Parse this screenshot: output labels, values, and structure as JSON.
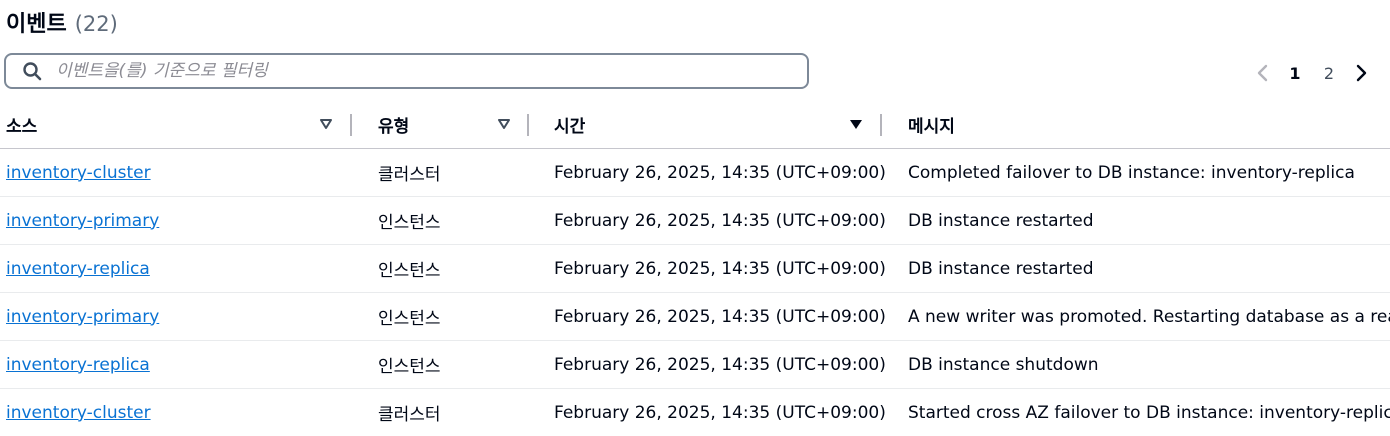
{
  "header": {
    "title": "이벤트",
    "count": "(22)"
  },
  "search": {
    "placeholder": "이벤트을(를) 기준으로 필터링"
  },
  "pagination": {
    "pages": [
      "1",
      "2"
    ],
    "current": "1"
  },
  "table": {
    "columns": [
      {
        "label": "소스"
      },
      {
        "label": "유형"
      },
      {
        "label": "시간"
      },
      {
        "label": "메시지"
      }
    ],
    "rows": [
      {
        "source": "inventory-cluster",
        "type": "클러스터",
        "time": "February 26, 2025, 14:35 (UTC+09:00)",
        "message": "Completed failover to DB instance: inventory-replica"
      },
      {
        "source": "inventory-primary",
        "type": "인스턴스",
        "time": "February 26, 2025, 14:35 (UTC+09:00)",
        "message": "DB instance restarted"
      },
      {
        "source": "inventory-replica",
        "type": "인스턴스",
        "time": "February 26, 2025, 14:35 (UTC+09:00)",
        "message": "DB instance restarted"
      },
      {
        "source": "inventory-primary",
        "type": "인스턴스",
        "time": "February 26, 2025, 14:35 (UTC+09:00)",
        "message": "A new writer was promoted. Restarting database as a reader."
      },
      {
        "source": "inventory-replica",
        "type": "인스턴스",
        "time": "February 26, 2025, 14:35 (UTC+09:00)",
        "message": "DB instance shutdown"
      },
      {
        "source": "inventory-cluster",
        "type": "클러스터",
        "time": "February 26, 2025, 14:35 (UTC+09:00)",
        "message": "Started cross AZ failover to DB instance: inventory-replica"
      }
    ]
  },
  "icons": {
    "search": "search-icon",
    "prev": "chevron-left-icon",
    "next": "chevron-right-icon",
    "sort_inactive": "caret-down-outline-icon",
    "sort_active": "caret-down-filled-icon"
  },
  "colors": {
    "link": "#0972d3",
    "text": "#000716",
    "muted": "#5f6b7a"
  }
}
